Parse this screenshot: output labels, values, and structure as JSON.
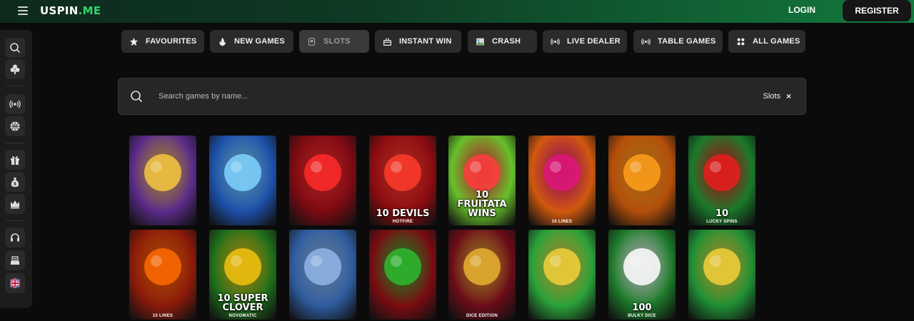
{
  "header": {
    "logo_main": "USPIN",
    "logo_accent": ".ME",
    "login_label": "LOGIN",
    "register_label": "REGISTER"
  },
  "sidebar": {
    "items": [
      {
        "name": "search",
        "icon": "search-icon"
      },
      {
        "name": "casino",
        "icon": "club-icon"
      },
      {
        "name": "live",
        "icon": "broadcast-icon"
      },
      {
        "name": "sports",
        "icon": "basketball-icon"
      },
      {
        "name": "promotions",
        "icon": "gift-icon"
      },
      {
        "name": "money",
        "icon": "money-bag-icon"
      },
      {
        "name": "vip",
        "icon": "crown-icon"
      },
      {
        "name": "support",
        "icon": "headset-icon"
      },
      {
        "name": "cashier",
        "icon": "cashier-icon"
      },
      {
        "name": "language",
        "icon": "uk-flag-icon"
      }
    ]
  },
  "tabs": [
    {
      "label": "FAVOURITES",
      "icon": "star-icon"
    },
    {
      "label": "NEW GAMES",
      "icon": "flame-icon"
    },
    {
      "label": "SLOTS",
      "icon": "slot-icon",
      "active": true
    },
    {
      "label": "INSTANT WIN",
      "icon": "basket-icon"
    },
    {
      "label": "CRASH",
      "icon": "image-icon"
    },
    {
      "label": "LIVE DEALER",
      "icon": "broadcast-icon"
    },
    {
      "label": "TABLE GAMES",
      "icon": "broadcast-icon"
    },
    {
      "label": "ALL GAMES",
      "icon": "grid-icon"
    }
  ],
  "search": {
    "placeholder": "Search games by name...",
    "filter_label": "Slots",
    "filter_clear": "×"
  },
  "games": [
    {
      "title": "",
      "sub": "",
      "bg": "#5a2b8a",
      "accent": "#f5c542"
    },
    {
      "title": "",
      "sub": "",
      "bg": "#1d4fa8",
      "accent": "#7fd3ff"
    },
    {
      "title": "",
      "sub": "",
      "bg": "#7a0a12",
      "accent": "#ff2a2a"
    },
    {
      "title": "10 DEVILS",
      "sub": "HOTFIRE",
      "bg": "#8a0c10",
      "accent": "#ff3b2a"
    },
    {
      "title": "10 FRUITATA WINS",
      "sub": "",
      "bg": "#66c12a",
      "accent": "#ff3d3d"
    },
    {
      "title": "",
      "sub": "10 LINES",
      "bg": "#d0590e",
      "accent": "#e0167a"
    },
    {
      "title": "",
      "sub": "",
      "bg": "#b24e0a",
      "accent": "#ff9f1a"
    },
    {
      "title": "10",
      "sub": "LUCKY SPINS",
      "bg": "#1a7a2a",
      "accent": "#e81d1d"
    },
    {
      "title": "",
      "sub": "10 LINES",
      "bg": "#8a1a0a",
      "accent": "#ff6a00"
    },
    {
      "title": "10 SUPER CLOVER",
      "sub": "NOVOMATIC",
      "bg": "#1f6e1b",
      "accent": "#f2c20f"
    },
    {
      "title": "",
      "sub": "",
      "bg": "#2e5b9e",
      "accent": "#8fb6e8"
    },
    {
      "title": "",
      "sub": "",
      "bg": "#7a0c12",
      "accent": "#2eb82e"
    },
    {
      "title": "",
      "sub": "DICE EDITION",
      "bg": "#6a0c18",
      "accent": "#e8b030"
    },
    {
      "title": "",
      "sub": "",
      "bg": "#2aa13a",
      "accent": "#f2d03a"
    },
    {
      "title": "100",
      "sub": "BULKY DICE",
      "bg": "#1c7a2a",
      "accent": "#ffffff"
    },
    {
      "title": "",
      "sub": "",
      "bg": "#1f8f34",
      "accent": "#f2d03a"
    }
  ],
  "colors": {
    "brand_green": "#34d46a",
    "tab_bg": "#2b2b2b",
    "page_bg": "#0b0b0b"
  }
}
